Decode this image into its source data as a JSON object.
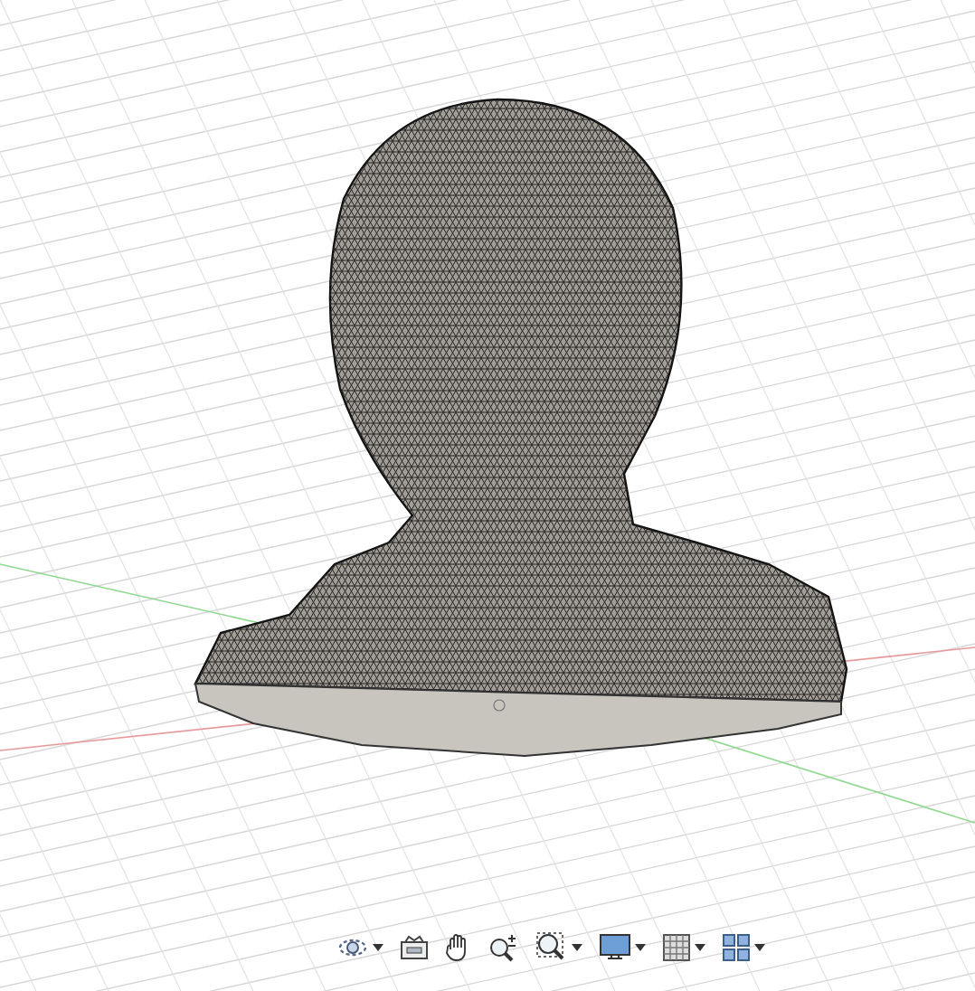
{
  "viewport": {
    "toolbar": [
      {
        "kind": "orbit",
        "dropdown": true
      },
      {
        "kind": "look",
        "dropdown": false
      },
      {
        "kind": "pan",
        "dropdown": false
      },
      {
        "kind": "zoom",
        "dropdown": false
      },
      {
        "kind": "fit",
        "dropdown": true
      },
      {
        "kind": "display",
        "dropdown": true
      },
      {
        "kind": "grid",
        "dropdown": true
      },
      {
        "kind": "views",
        "dropdown": true
      }
    ]
  }
}
